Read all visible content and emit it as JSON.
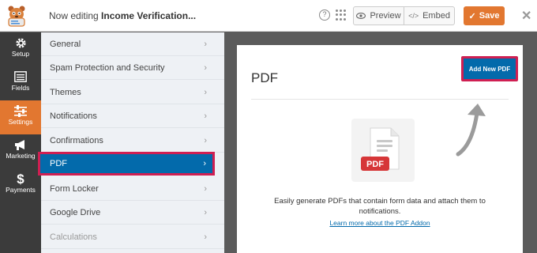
{
  "header": {
    "title_prefix": "Now editing",
    "form_name": "Income Verification...",
    "help_icon": "?",
    "preview_label": "Preview",
    "embed_label": "Embed",
    "save_label": "Save"
  },
  "rail": {
    "items": [
      {
        "label": "Setup",
        "icon": "gear-icon"
      },
      {
        "label": "Fields",
        "icon": "list-icon"
      },
      {
        "label": "Settings",
        "icon": "sliders-icon"
      },
      {
        "label": "Marketing",
        "icon": "megaphone-icon"
      },
      {
        "label": "Payments",
        "icon": "dollar-icon"
      }
    ],
    "active": "Settings"
  },
  "submenu": {
    "items": [
      {
        "label": "General"
      },
      {
        "label": "Spam Protection and Security"
      },
      {
        "label": "Themes"
      },
      {
        "label": "Notifications"
      },
      {
        "label": "Confirmations"
      },
      {
        "label": "PDF"
      },
      {
        "label": "Form Locker"
      },
      {
        "label": "Google Drive"
      },
      {
        "label": "Calculations"
      }
    ],
    "active": "PDF"
  },
  "panel": {
    "heading": "PDF",
    "add_button": "Add New PDF",
    "badge": "PDF",
    "description": "Easily generate PDFs that contain form data and attach them to notifications.",
    "learn_link": "Learn more about the PDF Addon"
  },
  "colors": {
    "accent": "#e27730",
    "primary": "#036aab",
    "highlight": "#cf1f52",
    "rail_bg": "#3b3b3b"
  }
}
